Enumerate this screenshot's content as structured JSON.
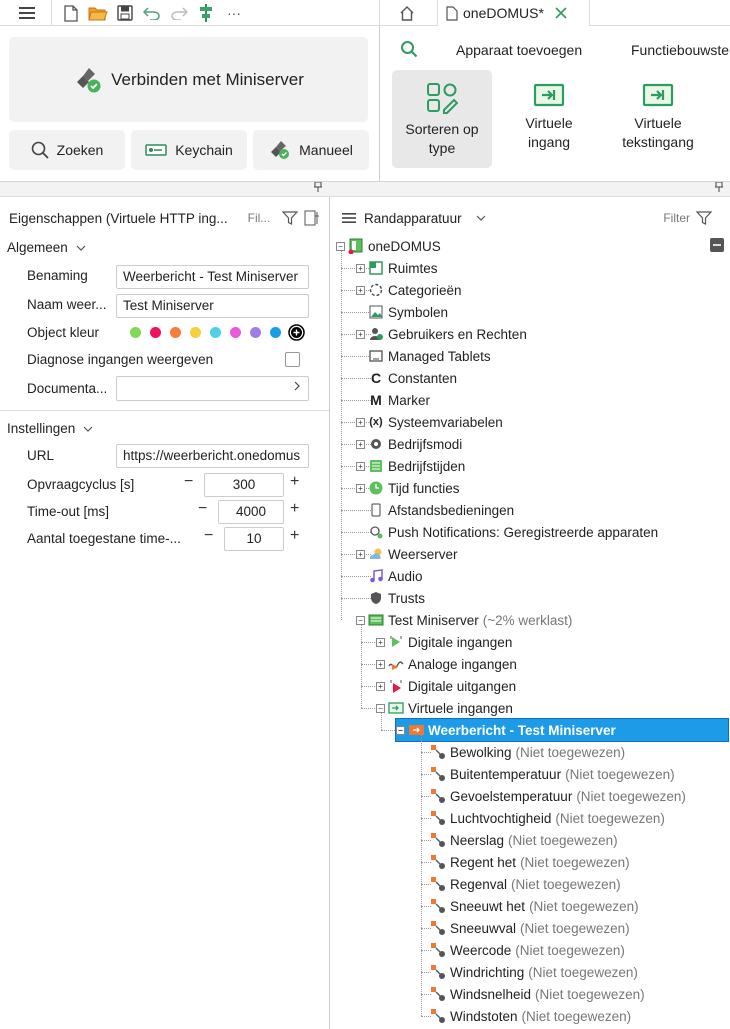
{
  "tab": {
    "title": "oneDOMUS*"
  },
  "ribbon": {
    "connect_label": "Verbinden met Miniserver",
    "search_label": "Zoeken",
    "keychain_label": "Keychain",
    "manual_label": "Manueel",
    "add_device_label": "Apparaat toevoegen",
    "function_blocks_label": "Functiebouwster",
    "tools": [
      {
        "line1": "Sorteren op",
        "line2": "type"
      },
      {
        "line1": "Virtuele",
        "line2": "ingang"
      },
      {
        "line1": "Virtuele",
        "line2": "tekstingang"
      }
    ]
  },
  "props": {
    "title": "Eigenschappen (Virtuele HTTP ing...",
    "filter_label": "Fil...",
    "general_section": "Algemeen",
    "name_label": "Benaming",
    "name_value": "Weerbericht - Test Miniserver",
    "shown_name_label": "Naam weer...",
    "shown_name_value": "Test Miniserver",
    "color_label": "Object kleur",
    "colors": [
      "#7ed957",
      "#f0145a",
      "#f57c3a",
      "#f5d03c",
      "#4fd0e6",
      "#e85ad6",
      "#a07bea",
      "#1e9be6"
    ],
    "diag_label": "Diagnose ingangen weergeven",
    "doc_label": "Documenta...",
    "settings_section": "Instellingen",
    "url_label": "URL",
    "url_value": "https://weerbericht.onedomus",
    "poll_label": "Opvraagcyclus [s]",
    "poll_value": "300",
    "timeout_label": "Time-out [ms]",
    "timeout_value": "4000",
    "retries_label": "Aantal toegestane time-...",
    "retries_value": "10"
  },
  "tree": {
    "header": "Randapparatuur",
    "filter_label": "Filter",
    "root": "oneDOMUS",
    "items": [
      {
        "label": "Ruimtes"
      },
      {
        "label": "Categorieën"
      },
      {
        "label": "Symbolen"
      },
      {
        "label": "Gebruikers en Rechten"
      },
      {
        "label": "Managed Tablets"
      },
      {
        "label": "Constanten"
      },
      {
        "label": "Marker"
      },
      {
        "label": "Systeemvariabelen"
      },
      {
        "label": "Bedrijfsmodi"
      },
      {
        "label": "Bedrijfstijden"
      },
      {
        "label": "Tijd functies"
      },
      {
        "label": "Afstandsbedieningen"
      },
      {
        "label": "Push Notifications: Geregistreerde apparaten"
      },
      {
        "label": "Weerserver"
      },
      {
        "label": "Audio"
      },
      {
        "label": "Trusts"
      }
    ],
    "miniserver": {
      "label": "Test Miniserver",
      "note": "(~2% werklast)"
    },
    "ms_children": [
      {
        "label": "Digitale ingangen"
      },
      {
        "label": "Analoge ingangen"
      },
      {
        "label": "Digitale uitgangen"
      },
      {
        "label": "Virtuele ingangen"
      }
    ],
    "selected": "Weerbericht - Test Miniserver",
    "unassigned": "(Niet toegewezen)",
    "leaves": [
      "Bewolking",
      "Buitentemperatuur",
      "Gevoelstemperatuur",
      "Luchtvochtigheid",
      "Neerslag",
      "Regent het",
      "Regenval",
      "Sneeuwt het",
      "Sneeuwval",
      "Weercode",
      "Windrichting",
      "Windsnelheid",
      "Windstoten"
    ]
  }
}
